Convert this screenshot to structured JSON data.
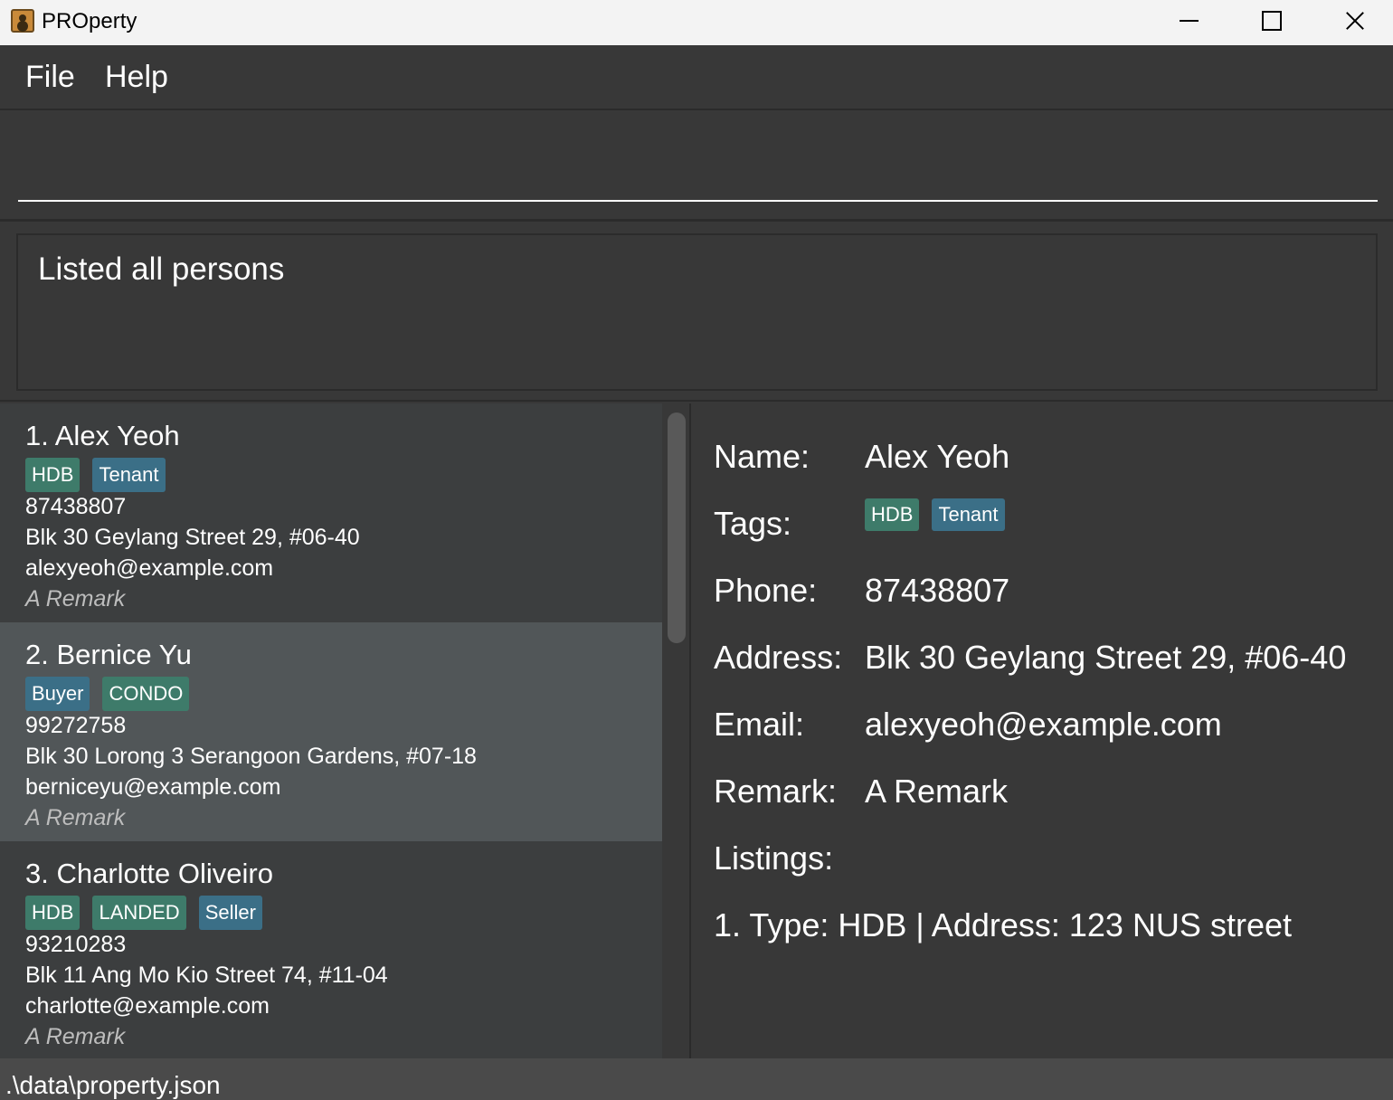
{
  "window": {
    "title": "PROperty"
  },
  "menu": {
    "file": "File",
    "help": "Help"
  },
  "command": {
    "value": "",
    "placeholder": ""
  },
  "result": {
    "text": "Listed all persons"
  },
  "persons": [
    {
      "name": "1. Alex Yeoh",
      "tags": [
        {
          "label": "HDB",
          "color": "#3e7b6a"
        },
        {
          "label": "Tenant",
          "color": "#3b6f87"
        }
      ],
      "phone": "87438807",
      "address": "Blk 30 Geylang Street 29, #06-40",
      "email": "alexyeoh@example.com",
      "remark": "A Remark"
    },
    {
      "name": "2. Bernice Yu",
      "tags": [
        {
          "label": "Buyer",
          "color": "#3b6f87"
        },
        {
          "label": "CONDO",
          "color": "#3e7b6a"
        }
      ],
      "phone": "99272758",
      "address": "Blk 30 Lorong 3 Serangoon Gardens, #07-18",
      "email": "berniceyu@example.com",
      "remark": "A Remark"
    },
    {
      "name": "3. Charlotte Oliveiro",
      "tags": [
        {
          "label": "HDB",
          "color": "#3e7b6a"
        },
        {
          "label": "LANDED",
          "color": "#3e7b6a"
        },
        {
          "label": "Seller",
          "color": "#3b6f87"
        }
      ],
      "phone": "93210283",
      "address": "Blk 11 Ang Mo Kio Street 74, #11-04",
      "email": "charlotte@example.com",
      "remark": "A Remark"
    }
  ],
  "detail": {
    "labels": {
      "name": "Name:",
      "tags": "Tags:",
      "phone": "Phone:",
      "address": "Address:",
      "email": "Email:",
      "remark": "Remark:",
      "listings": "Listings:"
    },
    "name": "Alex Yeoh",
    "tags": [
      {
        "label": "HDB",
        "color": "#3e7b6a"
      },
      {
        "label": "Tenant",
        "color": "#3b6f87"
      }
    ],
    "phone": "87438807",
    "address": "Blk 30 Geylang Street 29, #06-40",
    "email": "alexyeoh@example.com",
    "remark": "A Remark",
    "listings": [
      "1. Type: HDB | Address: 123 NUS street"
    ]
  },
  "status": {
    "file_path": ".\\data\\property.json"
  },
  "colors": {
    "background": "#383838",
    "card": "#3c3e3f",
    "card_selected": "#515658",
    "tag_green": "#3e7b6a",
    "tag_blue": "#3b6f87"
  }
}
